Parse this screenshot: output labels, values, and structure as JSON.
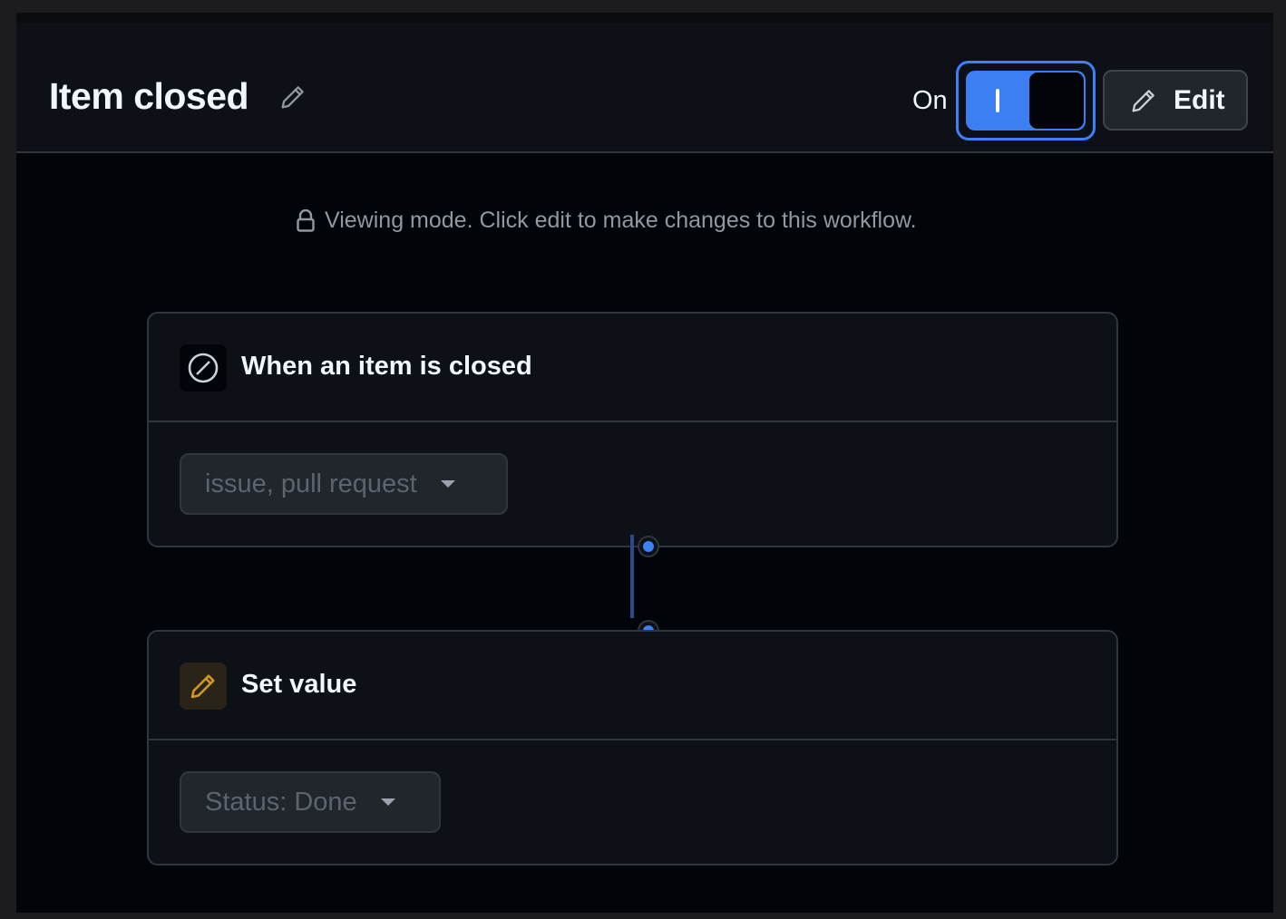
{
  "header": {
    "title": "Item closed",
    "toggle_label": "On",
    "toggle_state": "on",
    "edit_label": "Edit"
  },
  "notice": {
    "text": "Viewing mode. Click edit to make changes to this workflow."
  },
  "workflow": {
    "trigger": {
      "title": "When an item is closed",
      "icon": "circle-slash-icon",
      "dropdown_value": "issue, pull request"
    },
    "action": {
      "title": "Set value",
      "icon": "pencil-icon",
      "dropdown_value": "Status: Done"
    }
  },
  "colors": {
    "accent": "#3b82f6",
    "background": "#010409",
    "surface": "#0d1117",
    "border": "#30363d",
    "action_icon": "#d29922"
  }
}
